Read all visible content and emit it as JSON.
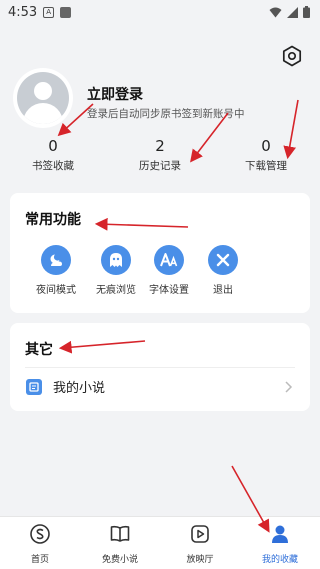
{
  "status_bar": {
    "time": "4:53",
    "icon_a": "A"
  },
  "profile": {
    "title": "立即登录",
    "subtitle": "登录后自动同步原书签到新账号中"
  },
  "stats": [
    {
      "value": "0",
      "label": "书签收藏"
    },
    {
      "value": "2",
      "label": "历史记录"
    },
    {
      "value": "0",
      "label": "下载管理"
    }
  ],
  "functions": {
    "title": "常用功能",
    "items": [
      {
        "label": "夜间模式",
        "icon": "night-mode-icon"
      },
      {
        "label": "无痕浏览",
        "icon": "ghost-icon"
      },
      {
        "label": "字体设置",
        "icon": "font-icon"
      },
      {
        "label": "退出",
        "icon": "close-icon"
      }
    ]
  },
  "others": {
    "title": "其它",
    "items": [
      {
        "label": "我的小说"
      }
    ]
  },
  "tabbar": {
    "items": [
      {
        "label": "首页",
        "active": false
      },
      {
        "label": "免费小说",
        "active": false
      },
      {
        "label": "放映厅",
        "active": false
      },
      {
        "label": "我的收藏",
        "active": true
      }
    ]
  },
  "colors": {
    "accent": "#4a8fe8",
    "annotation": "#d6242a",
    "active_tab": "#2f6fd9"
  }
}
